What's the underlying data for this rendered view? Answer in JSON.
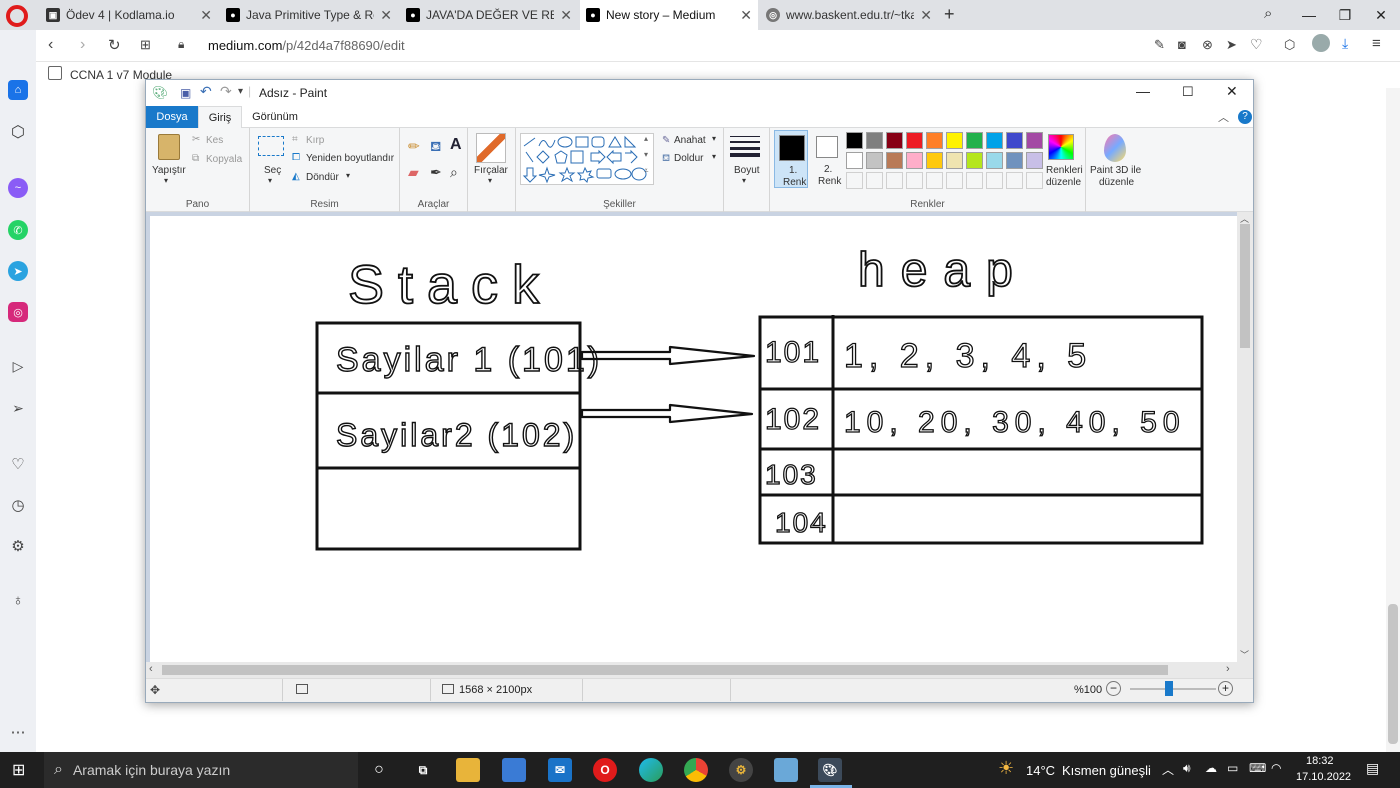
{
  "browser": {
    "tabs": [
      {
        "title": "Ödev 4 | Kodlama.io",
        "active": false
      },
      {
        "title": "Java Primitive Type & Refer",
        "active": false
      },
      {
        "title": "JAVA'DA DEĞER VE REFERA",
        "active": false
      },
      {
        "title": "New story – Medium",
        "active": true
      },
      {
        "title": "www.baskent.edu.tr/~tkara",
        "active": false
      }
    ],
    "url_host": "medium.com",
    "url_path": "/p/42d4a7f88690/edit",
    "bookmark": "CCNA 1 v7 Module"
  },
  "paint": {
    "title": "Adsız - Paint",
    "tabs": {
      "file": "Dosya",
      "home": "Giriş",
      "view": "Görünüm"
    },
    "groups": {
      "clipboard": {
        "label": "Pano",
        "paste": "Yapıştır",
        "cut": "Kes",
        "copy": "Kopyala"
      },
      "image": {
        "label": "Resim",
        "select": "Seç",
        "crop": "Kırp",
        "resize": "Yeniden boyutlandır",
        "rotate": "Döndür"
      },
      "tools": {
        "label": "Araçlar"
      },
      "brushes": {
        "label": "Fırçalar"
      },
      "shapes": {
        "label": "Şekiller",
        "outline": "Anahat",
        "fill": "Doldur"
      },
      "size": {
        "label": "Boyut"
      },
      "colors": {
        "label": "Renkler",
        "color1_line1": "1.",
        "color1_line2": "Renk",
        "color2_line1": "2.",
        "color2_line2": "Renk",
        "edit_line1": "Renkleri",
        "edit_line2": "düzenle",
        "palette_row1": [
          "#000000",
          "#7f7f7f",
          "#880015",
          "#ed1c24",
          "#ff7f27",
          "#fff200",
          "#22b14c",
          "#00a2e8",
          "#3f48cc",
          "#a349a4"
        ],
        "palette_row2": [
          "#ffffff",
          "#c3c3c3",
          "#b97a57",
          "#ffaec9",
          "#ffc90e",
          "#efe4b0",
          "#b5e61d",
          "#99d9ea",
          "#7092be",
          "#c8bfe7"
        ]
      },
      "paint3d": {
        "line1": "Paint 3D ile",
        "line2": "düzenle"
      }
    },
    "drawing": {
      "stack_title": "Stack",
      "heap_title": "heap",
      "stack_rows": [
        "Sayilar 1 (101)",
        "Sayilar2 (102)",
        ""
      ],
      "heap_rows": [
        {
          "addr": "101",
          "value": "1, 2, 3, 4, 5"
        },
        {
          "addr": "102",
          "value": "10, 20, 30, 40, 50"
        },
        {
          "addr": "103",
          "value": ""
        },
        {
          "addr": "104",
          "value": ""
        }
      ]
    },
    "status": {
      "dimensions": "1568 × 2100px",
      "zoom": "%100"
    }
  },
  "taskbar": {
    "search_placeholder": "Aramak için buraya yazın",
    "weather_temp": "14°C",
    "weather_desc": "Kısmen güneşli",
    "time": "18:32",
    "date": "17.10.2022"
  }
}
